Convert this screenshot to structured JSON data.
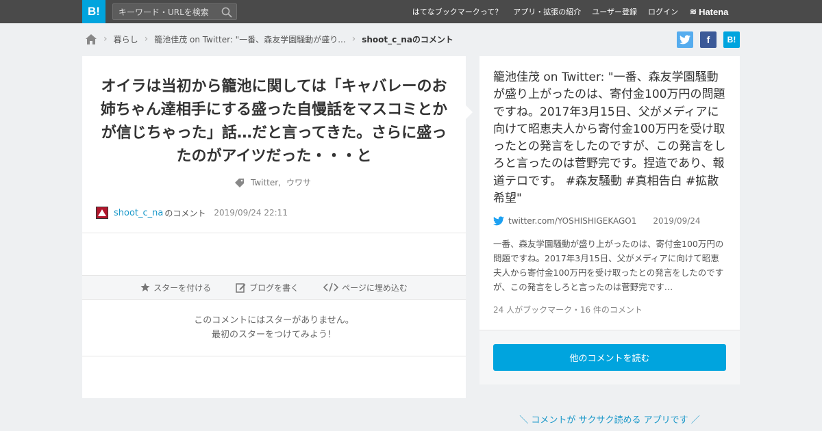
{
  "topbar": {
    "logo": "B!",
    "search_placeholder": "キーワード・URLを検索",
    "links": [
      "はてなブックマークって？",
      "アプリ・拡張の紹介",
      "ユーザー登録",
      "ログイン"
    ],
    "brand": "Hatena"
  },
  "breadcrumb": {
    "items": [
      "暮らし",
      "籠池佳茂 on Twitter: \"一番、森友学園騒動が盛り..."
    ],
    "current": "shoot_c_naのコメント"
  },
  "share": {
    "twitter": "t",
    "facebook": "f",
    "hatena": "B!"
  },
  "comment": {
    "text": "オイラは当初から籠池に関しては「キャバレーのお姉ちゃん達相手にする盛った自慢話をマスコミとかが信じちゃった」話…だと言ってきた。さらに盛ったのがアイツだった・・・と",
    "tags": [
      "Twitter,",
      "ウワサ"
    ],
    "username": "shoot_c_na",
    "username_suffix": "のコメント",
    "date": "2019/09/24 22:11"
  },
  "actions": {
    "star": "スターを付ける",
    "blog": "ブログを書く",
    "embed": "ページに埋め込む"
  },
  "no_star": {
    "line1": "このコメントにはスターがありません。",
    "line2": "最初のスターをつけてみよう！"
  },
  "entry": {
    "title": "籠池佳茂 on Twitter: \"一番、森友学園騒動が盛り上がったのは、寄付金100万円の問題ですね。2017年3月15日、父がメディアに向けて昭恵夫人から寄付金100万円を受け取ったとの発言をしたのですが、この発言をしろと言ったのは菅野完です。捏造であり、報道テロです。 #森友騒動 #真相告白 #拡散希望\"",
    "source": "twitter.com/YOSHISHIGEKAGO1",
    "date": "2019/09/24",
    "excerpt": "一番、森友学園騒動が盛り上がったのは、寄付金100万円の問題ですね。2017年3月15日、父がメディアに向けて昭恵夫人から寄付金100万円を受け取ったとの発言をしたのですが、この発言をしろと言ったのは菅野完です…",
    "counts": "24 人がブックマーク・16 件のコメント",
    "read_more": "他のコメントを読む"
  },
  "promo": "＼ コメントが サクサク読める アプリです ／",
  "colors": {
    "accent": "#00a4de",
    "topbar": "#4a4a4a",
    "link": "#1a98c9"
  }
}
